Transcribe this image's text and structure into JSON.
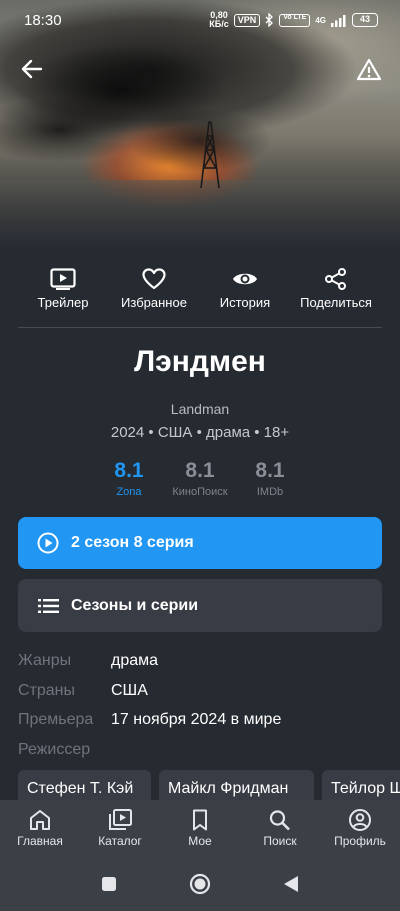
{
  "status_bar": {
    "time": "18:30",
    "net_speed_value": "0,80",
    "net_speed_unit": "КБ/с",
    "vpn": "VPN",
    "volte": "Vo LTE",
    "network": "4G",
    "battery": "43"
  },
  "actions": [
    {
      "label": "Трейлер",
      "icon": "trailer-icon"
    },
    {
      "label": "Избранное",
      "icon": "heart-icon"
    },
    {
      "label": "История",
      "icon": "eye-icon"
    },
    {
      "label": "Поделиться",
      "icon": "share-icon"
    }
  ],
  "title": "Лэндмен",
  "original_title": "Landman",
  "meta": "2024 • США • драма • 18+",
  "ratings": [
    {
      "value": "8.1",
      "source": "Zona"
    },
    {
      "value": "8.1",
      "source": "КиноПоиск"
    },
    {
      "value": "8.1",
      "source": "IMDb"
    }
  ],
  "play_button": "2 сезон 8 серия",
  "seasons_button": "Сезоны и серии",
  "info": [
    {
      "key": "Жанры",
      "value": "драма"
    },
    {
      "key": "Страны",
      "value": "США"
    },
    {
      "key": "Премьера",
      "value": "17 ноября 2024 в мире"
    },
    {
      "key": "Режиссер",
      "value": ""
    }
  ],
  "directors": [
    "Стефен Т. Кэй",
    "Майкл Фридман",
    "Тейлор Шеридан"
  ],
  "bottom_nav": [
    {
      "label": "Главная",
      "icon": "home-icon"
    },
    {
      "label": "Каталог",
      "icon": "catalog-icon"
    },
    {
      "label": "Мое",
      "icon": "bookmark-icon"
    },
    {
      "label": "Поиск",
      "icon": "search-icon"
    },
    {
      "label": "Профиль",
      "icon": "profile-icon"
    }
  ],
  "colors": {
    "accent": "#2196f3",
    "background": "#262a31",
    "card": "#383c44",
    "nav": "#3b3f46"
  }
}
